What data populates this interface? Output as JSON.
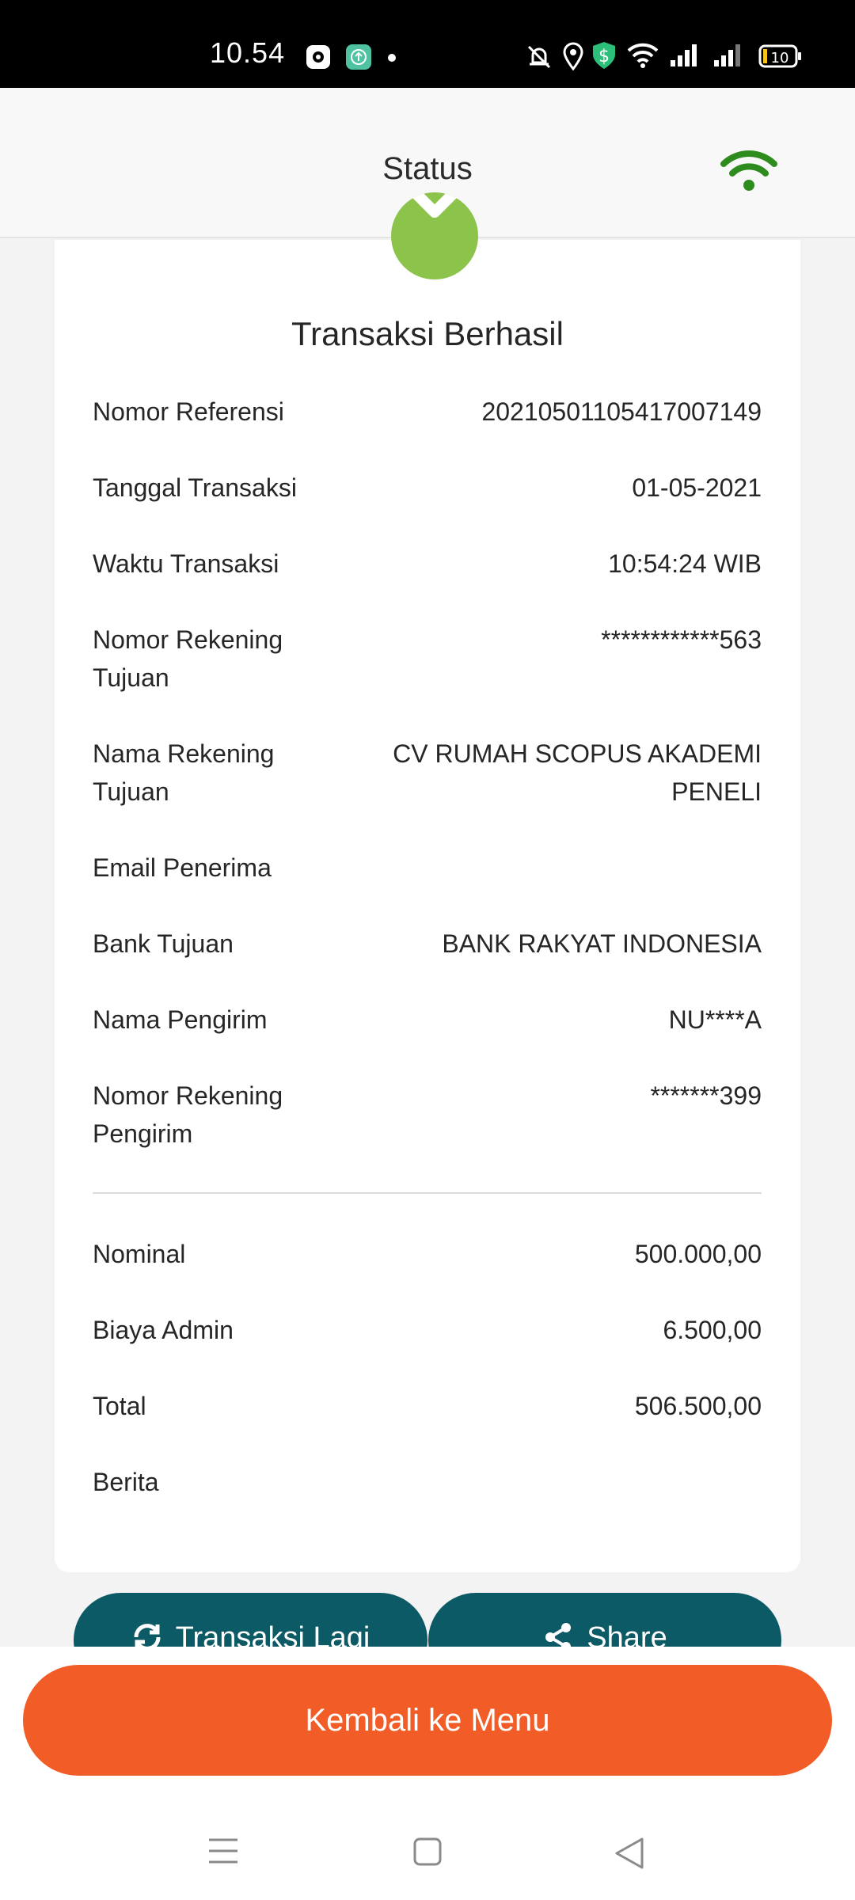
{
  "status_bar": {
    "time": "10.54",
    "battery": "10"
  },
  "header": {
    "title": "Status"
  },
  "receipt": {
    "title": "Transaksi Berhasil",
    "rows": [
      {
        "label": "Nomor Referensi",
        "value": "20210501105417007149"
      },
      {
        "label": "Tanggal Transaksi",
        "value": "01-05-2021"
      },
      {
        "label": "Waktu Transaksi",
        "value": "10:54:24 WIB"
      },
      {
        "label": "Nomor Rekening Tujuan",
        "value": "************563"
      },
      {
        "label": "Nama Rekening Tujuan",
        "value": "CV RUMAH SCOPUS AKADEMI PENELI"
      },
      {
        "label": "Email Penerima",
        "value": ""
      },
      {
        "label": "Bank Tujuan",
        "value": "BANK RAKYAT INDONESIA"
      },
      {
        "label": "Nama Pengirim",
        "value": "NU****A"
      },
      {
        "label": "Nomor Rekening Pengirim",
        "value": "*******399"
      }
    ],
    "amounts": [
      {
        "label": "Nominal",
        "value": "500.000,00"
      },
      {
        "label": "Biaya Admin",
        "value": "6.500,00"
      },
      {
        "label": "Total",
        "value": "506.500,00"
      },
      {
        "label": "Berita",
        "value": ""
      }
    ]
  },
  "actions": {
    "repeat_label": "Transaksi Lagi",
    "share_label": "Share",
    "back_label": "Kembali ke Menu"
  },
  "colors": {
    "success": "#8cc34a",
    "primary_teal": "#0c5a66",
    "accent_orange": "#f25c27",
    "wifi_green": "#2e8b1e"
  },
  "icons": {
    "success": "check-icon",
    "connection": "wifi-icon",
    "repeat": "refresh-icon",
    "share": "share-icon"
  }
}
